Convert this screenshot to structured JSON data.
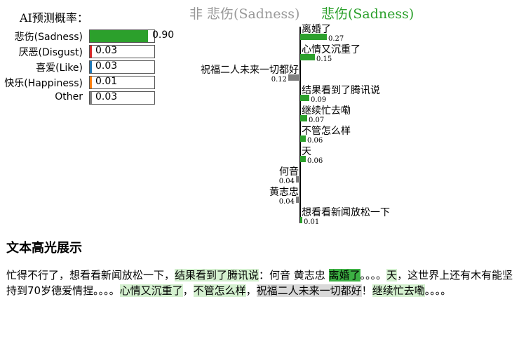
{
  "prob_panel": {
    "title": "AI预测概率：",
    "rows": [
      {
        "label": "悲伤(Sadness)",
        "value": "0.90",
        "fraction": 0.9,
        "color": "#2ca02c",
        "value_outside": true
      },
      {
        "label": "厌恶(Disgust)",
        "value": "0.03",
        "fraction": 0.03,
        "color": "#d62728",
        "value_outside": false
      },
      {
        "label": "喜爱(Like)",
        "value": "0.03",
        "fraction": 0.03,
        "color": "#1f77b4",
        "value_outside": false
      },
      {
        "label": "快乐(Happiness)",
        "value": "0.01",
        "fraction": 0.01,
        "color": "#ff7f0e",
        "value_outside": false
      },
      {
        "label": "Other",
        "value": "0.03",
        "fraction": 0.03,
        "color": "#7f7f7f",
        "value_outside": false
      }
    ]
  },
  "contrib": {
    "header_neg": "非 悲伤(Sadness)",
    "header_pos": "悲伤(Sadness)",
    "pos_color": "#2ca02c",
    "neg_color": "#808080",
    "words": [
      {
        "text": "离婚了",
        "value": "0.27",
        "weight": 0.27,
        "side": "pos"
      },
      {
        "text": "心情又沉重了",
        "value": "0.15",
        "weight": 0.15,
        "side": "pos"
      },
      {
        "text": "祝福二人未来一切都好",
        "value": "0.12",
        "weight": 0.12,
        "side": "neg"
      },
      {
        "text": "结果看到了腾讯说",
        "value": "0.09",
        "weight": 0.09,
        "side": "pos"
      },
      {
        "text": "继续忙去嘞",
        "value": "0.07",
        "weight": 0.07,
        "side": "pos"
      },
      {
        "text": "不管怎么样",
        "value": "0.06",
        "weight": 0.06,
        "side": "pos"
      },
      {
        "text": "天",
        "value": "0.06",
        "weight": 0.06,
        "side": "pos"
      },
      {
        "text": "何音",
        "value": "0.04",
        "weight": 0.04,
        "side": "neg"
      },
      {
        "text": "黄志忠",
        "value": "0.04",
        "weight": 0.04,
        "side": "neg"
      },
      {
        "text": "想看看新闻放松一下",
        "value": "0.01",
        "weight": 0.01,
        "side": "pos"
      }
    ]
  },
  "highlight": {
    "title": "文本高光展示",
    "segments": [
      {
        "text": "忙得不行了，想看看新闻放松一下，",
        "style": "none"
      },
      {
        "text": "结果看到了腾讯说",
        "style": "pos"
      },
      {
        "text": "：何音 黄志忠 ",
        "style": "none"
      },
      {
        "text": "离婚了",
        "style": "strong"
      },
      {
        "text": "。。。。",
        "style": "none"
      },
      {
        "text": "天",
        "style": "pos"
      },
      {
        "text": "，这世界上还有木有能坚持到70岁德爱情捏。。。。",
        "style": "none"
      },
      {
        "text": "心情又沉重了",
        "style": "pos"
      },
      {
        "text": "，",
        "style": "none"
      },
      {
        "text": "不管怎么样",
        "style": "pos"
      },
      {
        "text": "，",
        "style": "none"
      },
      {
        "text": "祝福二人未来一切都好",
        "style": "neg"
      },
      {
        "text": "！",
        "style": "none"
      },
      {
        "text": "继续忙去嘞",
        "style": "pos"
      },
      {
        "text": "。。。。",
        "style": "none"
      }
    ]
  }
}
